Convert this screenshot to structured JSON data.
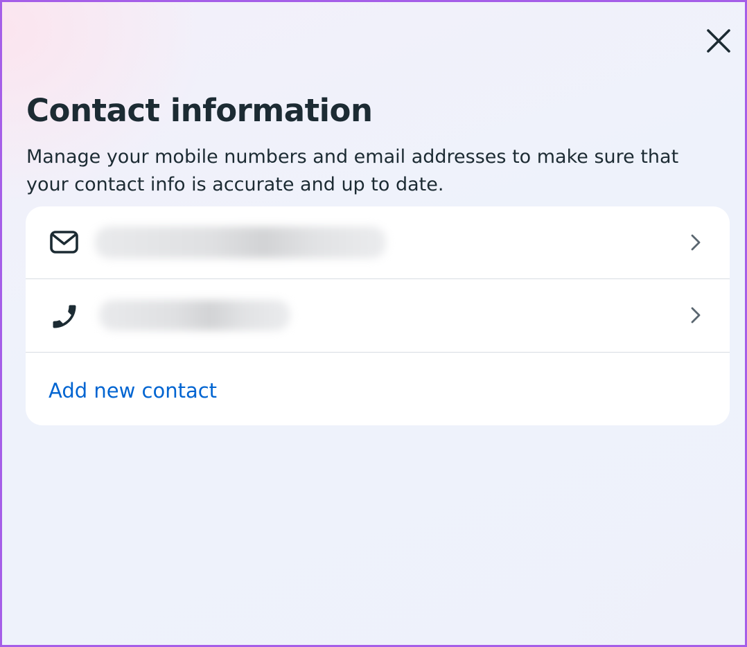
{
  "dialog": {
    "title": "Contact information",
    "description": "Manage your mobile numbers and email addresses to make sure that your contact info is accurate and up to date.",
    "close_icon": "close-icon"
  },
  "contacts": [
    {
      "type": "email",
      "icon": "envelope-icon",
      "value": "",
      "redacted": true,
      "action_icon": "chevron-right-icon"
    },
    {
      "type": "phone",
      "icon": "phone-icon",
      "value": "",
      "redacted": true,
      "action_icon": "chevron-right-icon"
    }
  ],
  "actions": {
    "add_contact_label": "Add new contact"
  },
  "colors": {
    "frame_border": "#a55ee8",
    "text_primary": "#1c2b33",
    "link": "#0064d1",
    "card_bg": "#ffffff",
    "divider": "#d7dce2"
  }
}
